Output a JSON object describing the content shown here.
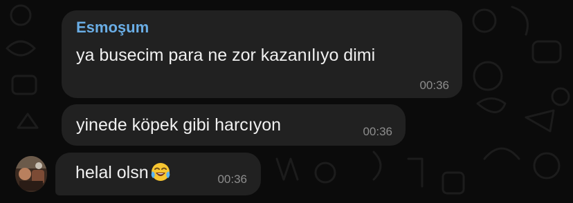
{
  "messages": [
    {
      "sender": "Esmoşum",
      "text": "ya busecim para ne zor kazanılıyo dimi",
      "time": "00:36"
    },
    {
      "text": "yinede köpek gibi harcıyon",
      "time": "00:36"
    },
    {
      "text": "helal olsn",
      "emoji": "face-with-tears-of-joy",
      "time": "00:36"
    }
  ],
  "colors": {
    "background": "#0b0b0b",
    "bubble": "#212121",
    "sender_name": "#6aaee6",
    "text": "#f0f0f0",
    "timestamp": "#8d8d8d"
  }
}
